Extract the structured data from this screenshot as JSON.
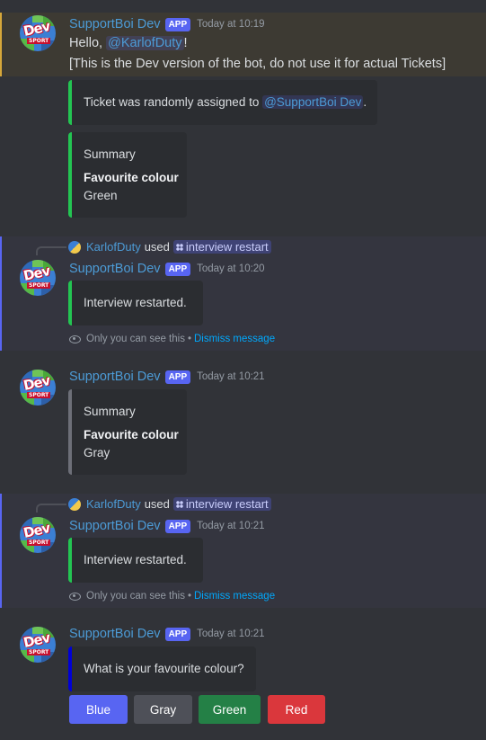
{
  "bot": {
    "name": "SupportBoi Dev",
    "tag": "APP",
    "avatar_text": "Dev",
    "avatar_sub": "SPORT"
  },
  "messages": [
    {
      "timestamp": "Today at 10:19",
      "greeting": "Hello, ",
      "mention": "@KarlofDuty",
      "greeting_end": "!",
      "note": "[This is the Dev version of the bot, do not use it for actual Tickets]",
      "assign_prefix": "Ticket was randomly assigned to ",
      "assign_mention": "@SupportBoi Dev",
      "assign_suffix": ".",
      "summary_title": "Summary",
      "summary_field": "Favourite colour",
      "summary_value": "Green"
    },
    {
      "reply_user": "KarlofDuty",
      "reply_used": "used",
      "reply_command": "interview restart",
      "timestamp": "Today at 10:20",
      "embed_text": "Interview restarted.",
      "ephemeral_text": "Only you can see this",
      "ephemeral_dot": "•",
      "dismiss": "Dismiss message"
    },
    {
      "timestamp": "Today at 10:21",
      "summary_title": "Summary",
      "summary_field": "Favourite colour",
      "summary_value": "Gray"
    },
    {
      "reply_user": "KarlofDuty",
      "reply_used": "used",
      "reply_command": "interview restart",
      "timestamp": "Today at 10:21",
      "embed_text": "Interview restarted.",
      "ephemeral_text": "Only you can see this",
      "ephemeral_dot": "•",
      "dismiss": "Dismiss message"
    },
    {
      "timestamp": "Today at 10:21",
      "question": "What is your favourite colour?",
      "buttons": [
        "Blue",
        "Gray",
        "Green",
        "Red"
      ]
    }
  ],
  "colors": {
    "background": "#313338",
    "embed_green": "#23c552",
    "embed_gray": "#6d6f78",
    "embed_blue": "#0000d6",
    "btn_blue": "#5865f2",
    "btn_gray": "#4e5058",
    "btn_green": "#248046",
    "btn_red": "#da373c"
  }
}
